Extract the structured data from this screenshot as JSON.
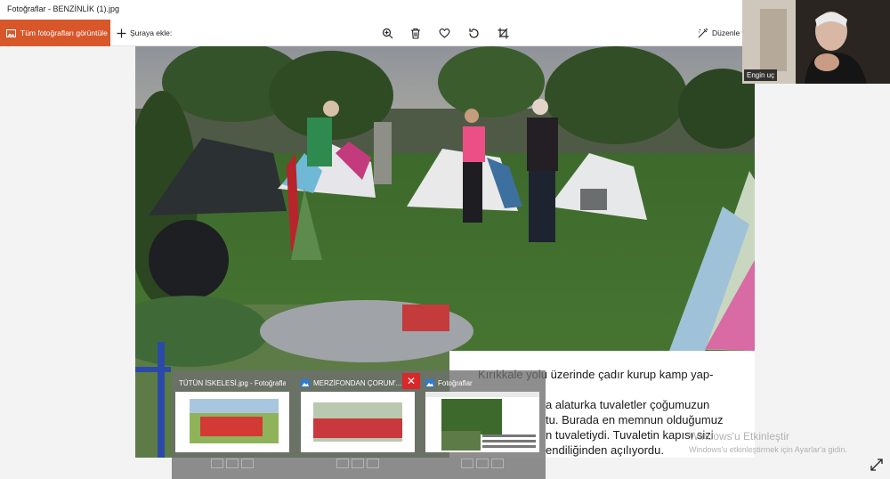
{
  "window": {
    "title": "Fotoğraflar - BENZİNLİK (1).jpg"
  },
  "toolbar": {
    "view_all_label": "Tüm fotoğrafları görüntüle",
    "add_to_label": "Şuraya ekle:",
    "edit_label": "Düzenle v"
  },
  "webcam": {
    "participant_name": "Engin uç"
  },
  "document": {
    "lines": [
      "Kırıkkale yolu üzerinde çadır kurup kamp yap-",
      "",
      "a alaturka tuvaletler çoğumuzun",
      "tu. Burada en memnun olduğumuz",
      "n tuvaletiydi. Tuvaletin kapısı sizi",
      "endiliğinden açılıyordu."
    ]
  },
  "previews": [
    {
      "label": "TÜTÜN İSKELESİ.jpg - Fotoğraflar"
    },
    {
      "label": "MERZİFONDAN ÇORUM'..."
    },
    {
      "label": "Fotoğraflar"
    }
  ],
  "watermark": {
    "line1": "Windows'u Etkinleştir",
    "line2": "Windows'u etkinleştirmek için Ayarlar'a gidin."
  },
  "colors": {
    "accent": "#d7572b",
    "close_red": "#d9282a"
  },
  "icons": {
    "zoom": "zoom-icon",
    "delete": "trash-icon",
    "favorite": "heart-icon",
    "rotate": "rotate-icon",
    "crop": "crop-icon"
  }
}
